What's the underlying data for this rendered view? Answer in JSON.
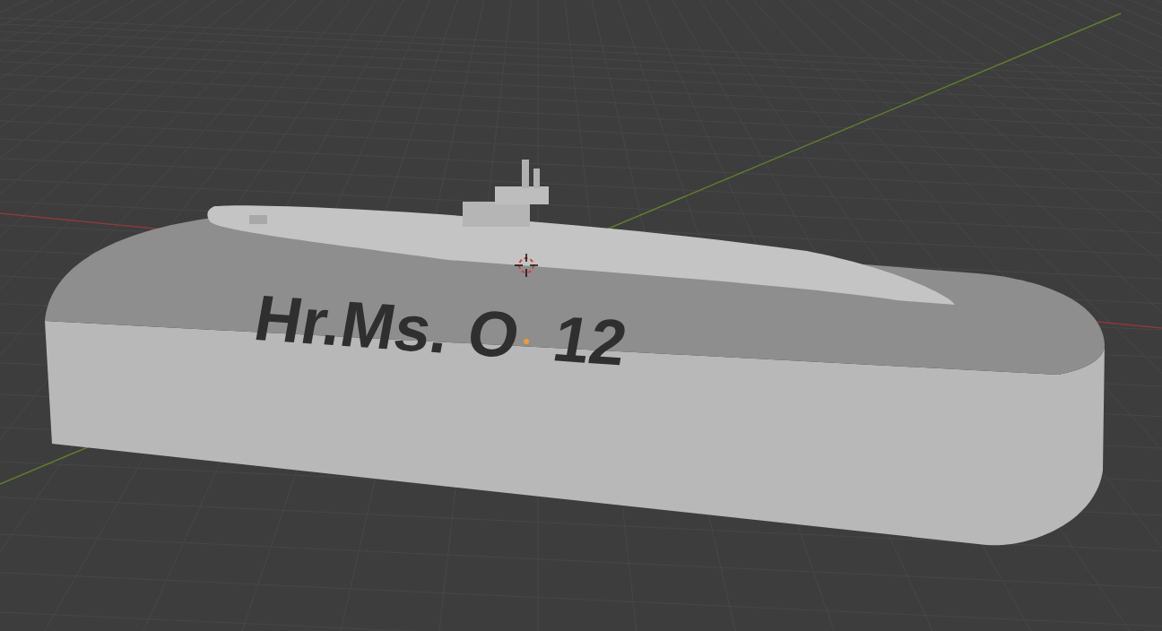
{
  "viewport": {
    "model_text": [
      "Hr.Ms.",
      "O",
      "12"
    ]
  }
}
